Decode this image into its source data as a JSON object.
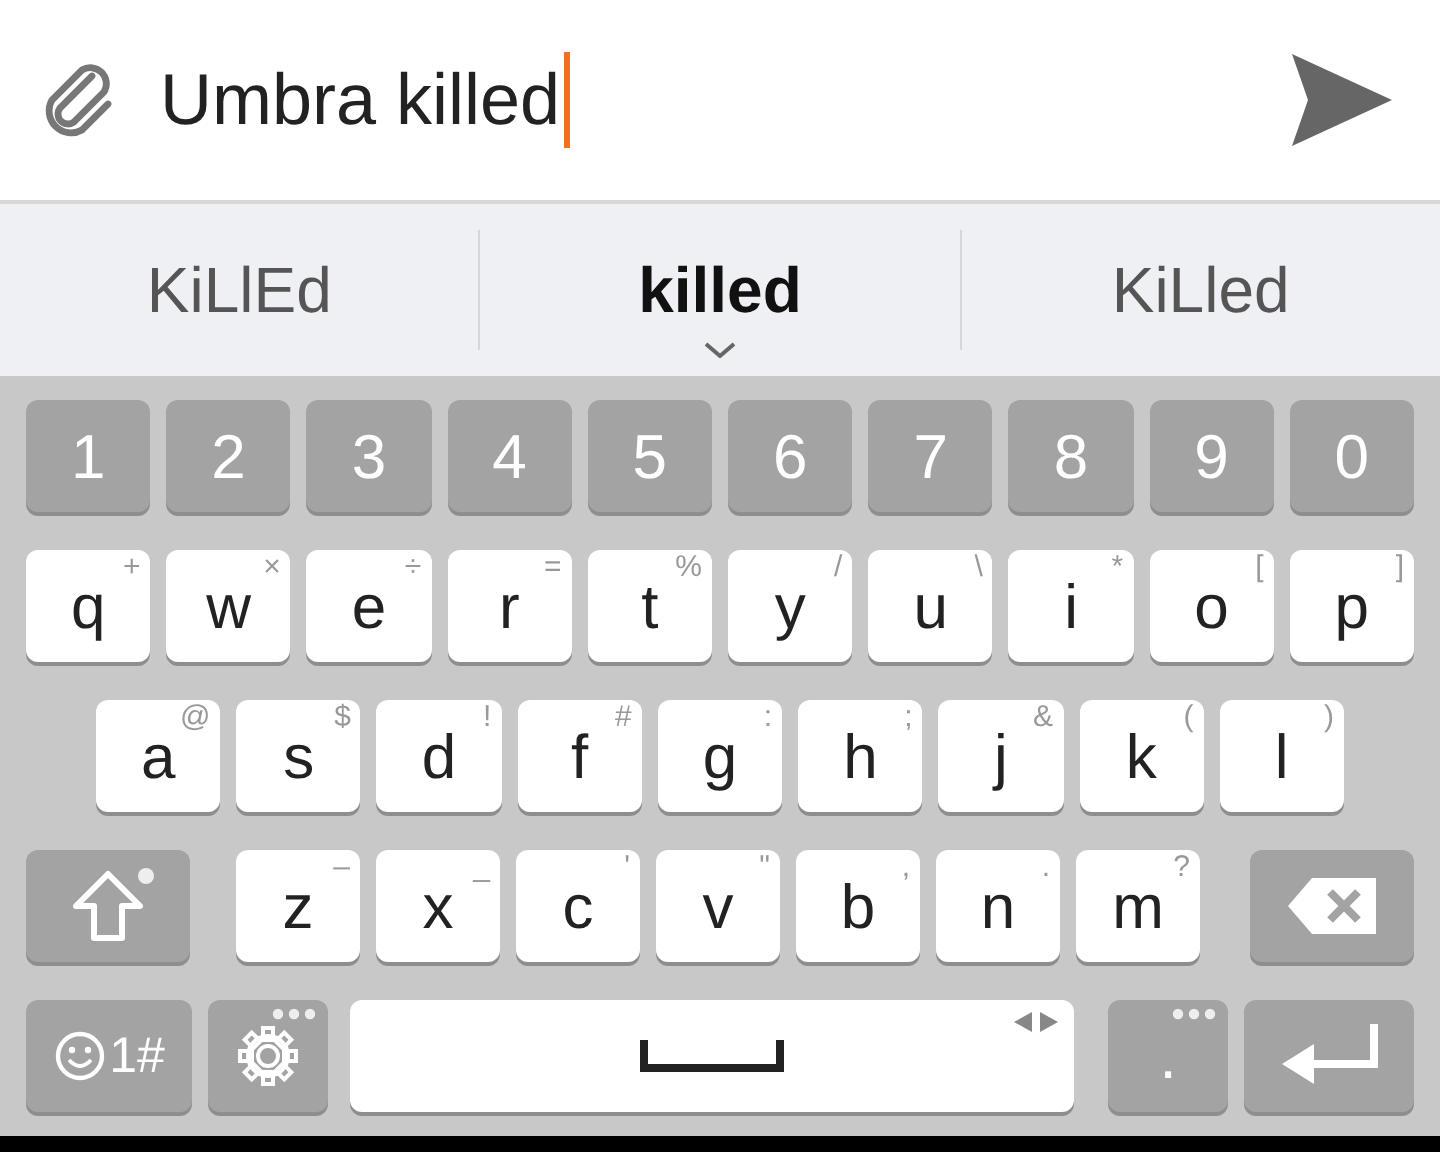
{
  "input": {
    "value": "Umbra killed"
  },
  "suggestions": [
    {
      "text": "KiLlEd",
      "selected": false
    },
    {
      "text": "killed",
      "selected": true
    },
    {
      "text": "KiLled",
      "selected": false
    }
  ],
  "keyboard": {
    "rows": [
      [
        {
          "kind": "number",
          "label": "1"
        },
        {
          "kind": "number",
          "label": "2"
        },
        {
          "kind": "number",
          "label": "3"
        },
        {
          "kind": "number",
          "label": "4"
        },
        {
          "kind": "number",
          "label": "5"
        },
        {
          "kind": "number",
          "label": "6"
        },
        {
          "kind": "number",
          "label": "7"
        },
        {
          "kind": "number",
          "label": "8"
        },
        {
          "kind": "number",
          "label": "9"
        },
        {
          "kind": "number",
          "label": "0"
        }
      ],
      [
        {
          "kind": "letter",
          "label": "q",
          "hint": "+"
        },
        {
          "kind": "letter",
          "label": "w",
          "hint": "×"
        },
        {
          "kind": "letter",
          "label": "e",
          "hint": "÷"
        },
        {
          "kind": "letter",
          "label": "r",
          "hint": "="
        },
        {
          "kind": "letter",
          "label": "t",
          "hint": "%"
        },
        {
          "kind": "letter",
          "label": "y",
          "hint": "/"
        },
        {
          "kind": "letter",
          "label": "u",
          "hint": "\\"
        },
        {
          "kind": "letter",
          "label": "i",
          "hint": "*"
        },
        {
          "kind": "letter",
          "label": "o",
          "hint": "["
        },
        {
          "kind": "letter",
          "label": "p",
          "hint": "]"
        }
      ],
      [
        {
          "kind": "letter",
          "label": "a",
          "hint": "@"
        },
        {
          "kind": "letter",
          "label": "s",
          "hint": "$"
        },
        {
          "kind": "letter",
          "label": "d",
          "hint": "!"
        },
        {
          "kind": "letter",
          "label": "f",
          "hint": "#"
        },
        {
          "kind": "letter",
          "label": "g",
          "hint": ":"
        },
        {
          "kind": "letter",
          "label": "h",
          "hint": ";"
        },
        {
          "kind": "letter",
          "label": "j",
          "hint": "&"
        },
        {
          "kind": "letter",
          "label": "k",
          "hint": "("
        },
        {
          "kind": "letter",
          "label": "l",
          "hint": ")"
        }
      ],
      [
        {
          "kind": "shift"
        },
        {
          "kind": "letter",
          "label": "z",
          "hint": "–"
        },
        {
          "kind": "letter",
          "label": "x",
          "hint": "_"
        },
        {
          "kind": "letter",
          "label": "c",
          "hint": "'"
        },
        {
          "kind": "letter",
          "label": "v",
          "hint": "\""
        },
        {
          "kind": "letter",
          "label": "b",
          "hint": ","
        },
        {
          "kind": "letter",
          "label": "n",
          "hint": "."
        },
        {
          "kind": "letter",
          "label": "m",
          "hint": "?"
        },
        {
          "kind": "backspace"
        }
      ],
      [
        {
          "kind": "emoji",
          "label": "1#"
        },
        {
          "kind": "settings"
        },
        {
          "kind": "space"
        },
        {
          "kind": "period",
          "label": "."
        },
        {
          "kind": "enter"
        }
      ]
    ]
  }
}
